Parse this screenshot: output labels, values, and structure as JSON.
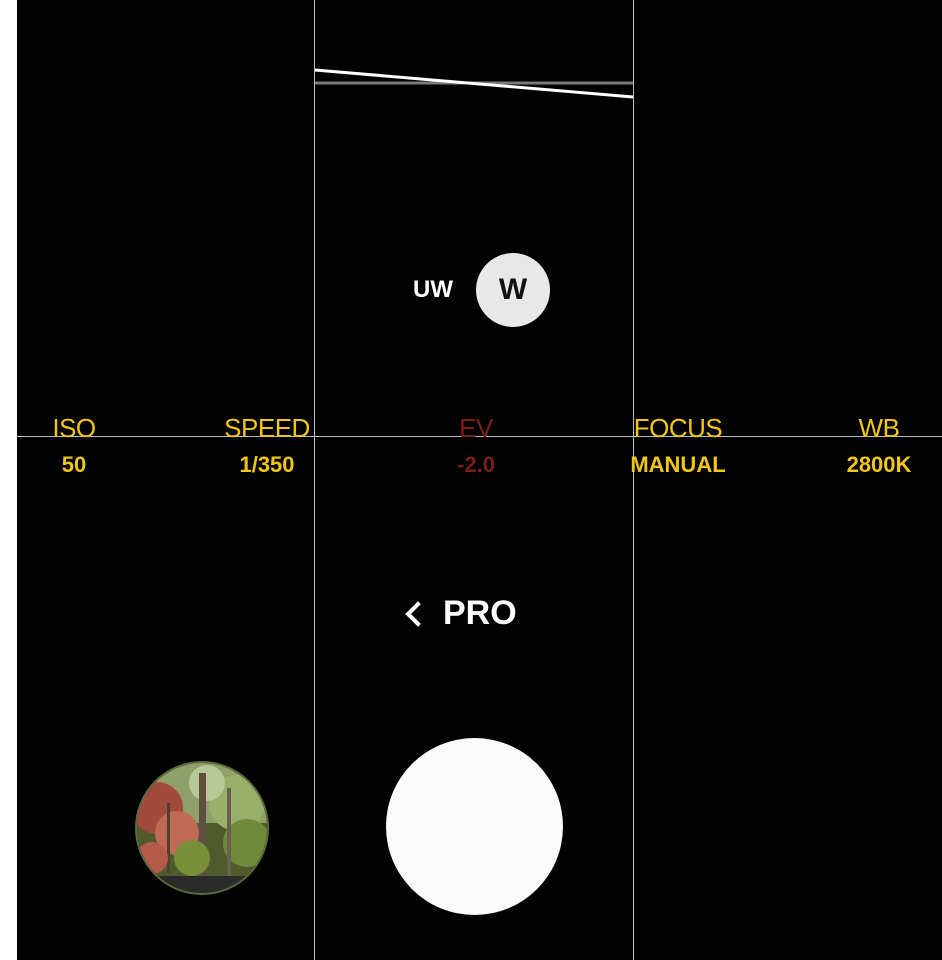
{
  "lens": {
    "ultra_wide_label": "UW",
    "wide_label": "W"
  },
  "pro_params": [
    {
      "label": "ISO",
      "value": "50",
      "color": "#f2c614",
      "enabled": true
    },
    {
      "label": "SPEED",
      "value": "1/350",
      "color": "#f2c614",
      "enabled": true
    },
    {
      "label": "EV",
      "value": "-2.0",
      "color": "#7a1f17",
      "enabled": false
    },
    {
      "label": "FOCUS",
      "value": "MANUAL",
      "color": "#f2c614",
      "enabled": true
    },
    {
      "label": "WB",
      "value": "2800K",
      "color": "#f2c614",
      "enabled": true
    }
  ],
  "mode": {
    "label": "PRO",
    "icon": "chevron-left-icon"
  },
  "colors": {
    "accent_yellow": "#f2c614",
    "disabled_red": "#7a1f17",
    "background": "#020202"
  }
}
